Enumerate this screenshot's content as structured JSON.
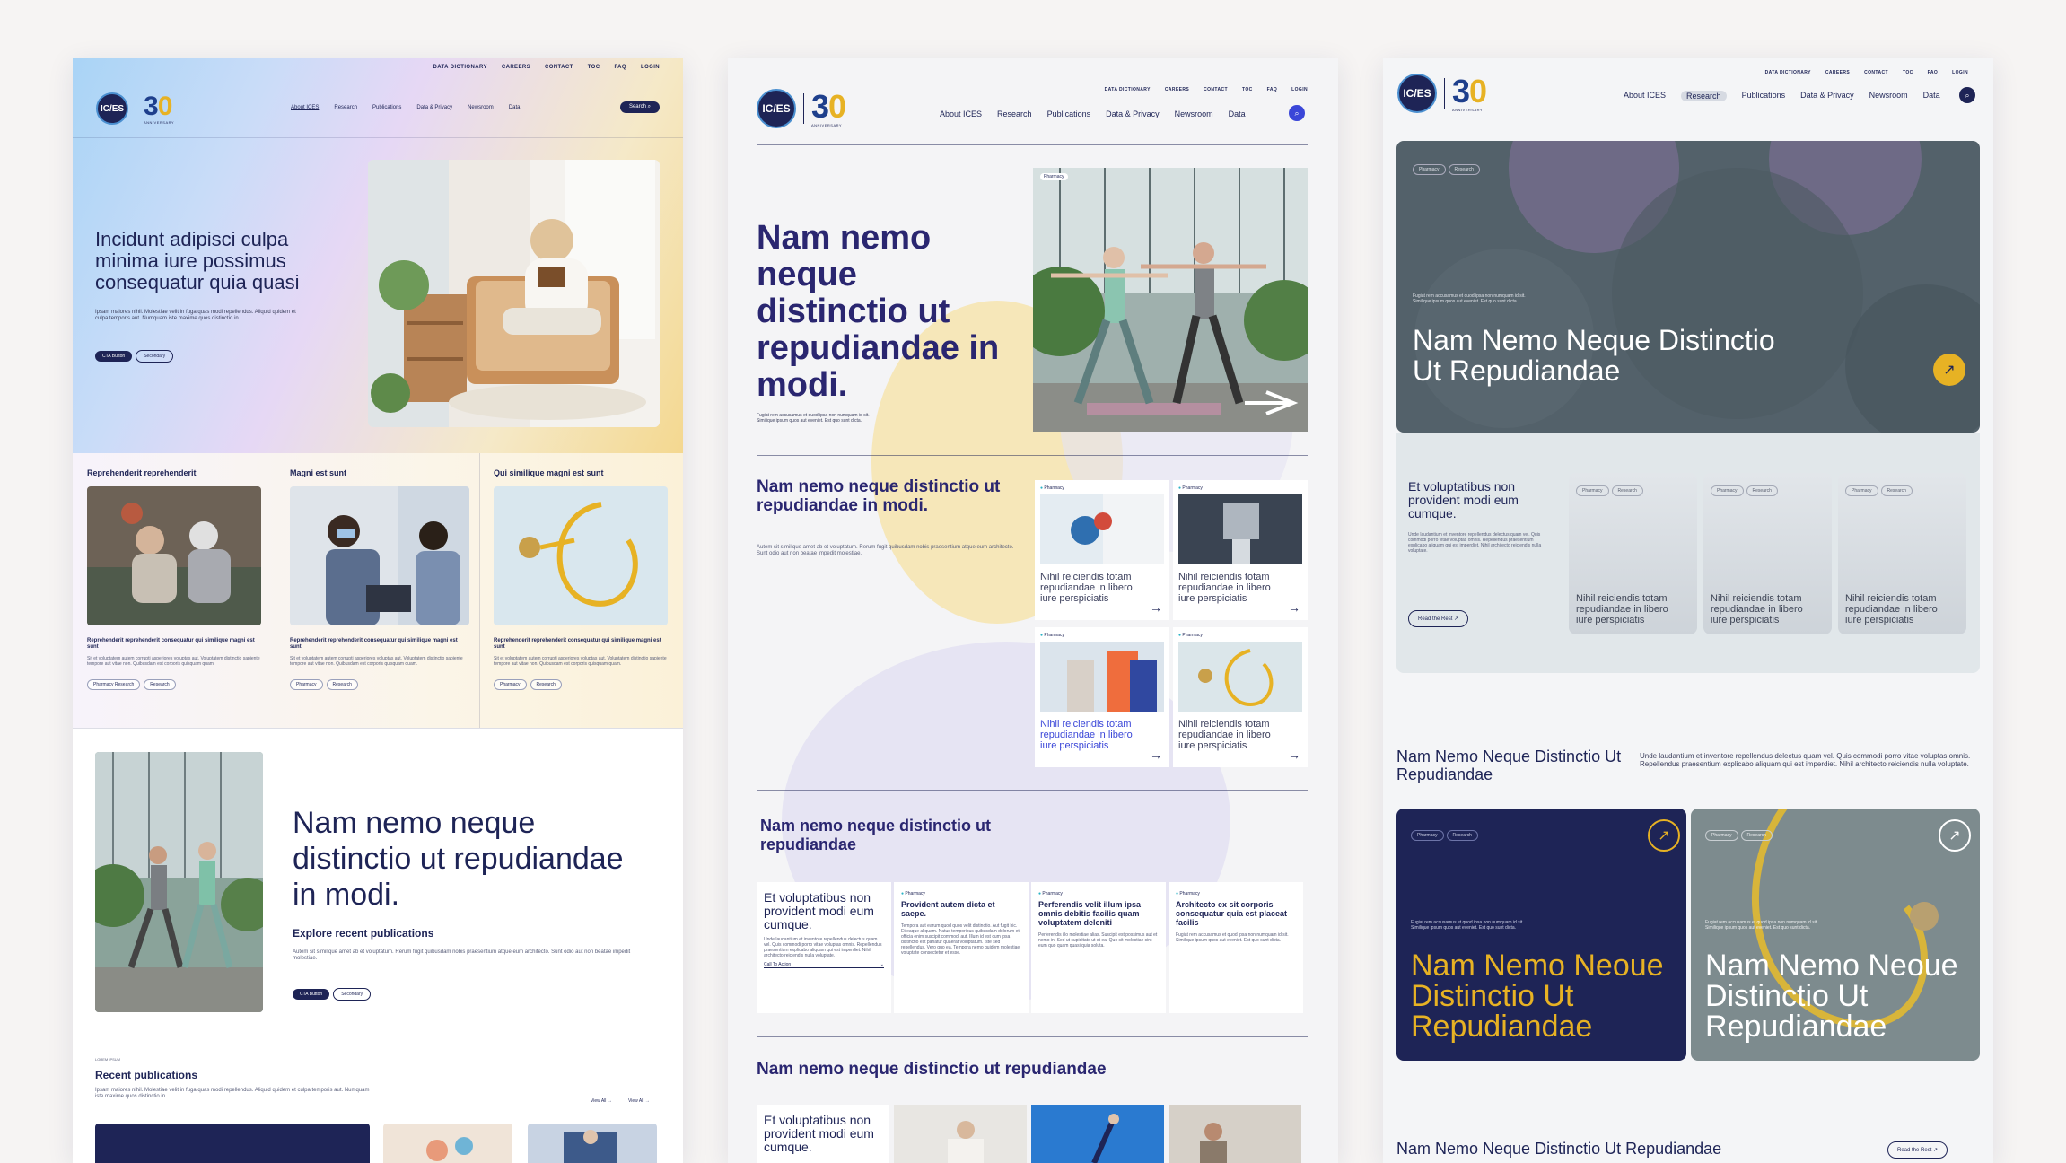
{
  "brand": {
    "logo_text": "IC/ES",
    "anniversary_number": "30",
    "anniversary_sub": "ANNIVERSARY"
  },
  "utility_nav": [
    "DATA DICTIONARY",
    "CAREERS",
    "CONTACT",
    "TOC",
    "FAQ",
    "LOGIN"
  ],
  "main_nav": [
    "About ICES",
    "Research",
    "Publications",
    "Data & Privacy",
    "Newsroom",
    "Data"
  ],
  "search_label": "Search",
  "p1": {
    "hero_title": "Incidunt adipisci culpa minima iure possimus consequatur quia quasi",
    "hero_body": "Ipsam maiores nihil. Molestiae velit in fuga quas modi repellendus. Aliquid quidem et culpa temporis aut. Numquam iste maxime quos distinctio in.",
    "cta_primary": "CTA Button",
    "cta_secondary": "Secondary",
    "cards": [
      {
        "heading": "Reprehenderit reprehenderit",
        "title": "Reprehenderit reprehenderit consequatur qui similique magni est sunt",
        "body": "Sit et voluptatem autem corrupti asperiores voluptas aut. Voluptatem distinctio sapiente tempore aut vitae non. Quibusdam est corporis quisquam quam.",
        "tags": [
          "Pharmacy Research",
          "Research"
        ]
      },
      {
        "heading": "Magni est sunt",
        "title": "Reprehenderit reprehenderit consequatur qui similique magni est sunt",
        "body": "Sit et voluptatem autem corrupti asperiores voluptas aut. Voluptatem distinctio sapiente tempore aut vitae non. Quibusdam est corporis quisquam quam.",
        "tags": [
          "Pharmacy",
          "Research"
        ]
      },
      {
        "heading": "Qui similique magni est sunt",
        "title": "Reprehenderit reprehenderit consequatur qui similique magni est sunt",
        "body": "Sit et voluptatem autem corrupti asperiores voluptas aut. Voluptatem distinctio sapiente tempore aut vitae non. Quibusdam est corporis quisquam quam.",
        "tags": [
          "Pharmacy",
          "Research"
        ]
      }
    ],
    "feature_title": "Nam nemo neque distinctio ut repudiandae in modi.",
    "feature_sub": "Explore recent publications",
    "feature_body": "Autem sit similique amet ab et voluptatum. Rerum fugit quibusdam nobis praesentium atque eum architecto. Sunt odio aut non beatae impedit molestiae.",
    "recent_eyebrow": "LOREM IPSUM",
    "recent_title": "Recent publications",
    "recent_body": "Ipsam maiores nihil. Molestiae velit in fuga quas modi repellendus. Aliquid quidem et culpa temporis aut. Numquam iste maxime quos distinctio in.",
    "view_all_1": "View All",
    "view_all_2": "View All"
  },
  "p2": {
    "hero_title": "Nam nemo neque distinctio ut repudiandae in modi.",
    "hero_body": "Fugiat rem accusamus et quod ipsa non numquam id sit. Similique ipsum quos aut eveniet. Est quo sunt dicta.",
    "hero_tag": "Pharmacy",
    "sec1_title": "Nam nemo neque distinctio ut repudiandae in modi.",
    "sec1_body": "Autem sit similique amet ab et voluptatum. Rerum fugit quibusdam nobis praesentium atque eum architecto. Sunt odio aut non beatae impedit molestiae.",
    "cards": [
      {
        "tag": "Pharmacy",
        "title": "Nihil reiciendis totam repudiandae in libero iure perspiciatis"
      },
      {
        "tag": "Pharmacy",
        "title": "Nihil reiciendis totam repudiandae in libero iure perspiciatis"
      },
      {
        "tag": "Pharmacy",
        "title": "Nihil reiciendis totam repudiandae in libero iure perspiciatis"
      },
      {
        "tag": "Pharmacy",
        "title": "Nihil reiciendis totam repudiandae in libero iure perspiciatis"
      }
    ],
    "sec2_title": "Nam nemo neque distinctio ut repudiandae",
    "row_cards": [
      {
        "tag": "",
        "title": "Et voluptatibus non provident modi eum cumque.",
        "body": "Unde laudantium et inventore repellendus delectus quam vel. Quis commodi porro vitae voluptas omnis. Repellendus praesentium explicabo aliquam qui est imperdiet. Nihil architecto reiciendis nulla voluptate.",
        "cta": "Call To Action"
      },
      {
        "tag": "Pharmacy",
        "title": "Provident autem dicta et saepe.",
        "body": "Tempora aut earum quod quos velit distinctio. Aut fugit hic. Et eaque aliquam. Natus temporibus quibusdam dolorum et officia enim suscipit commodi aut. Illum id est cum ipsa distinctio est pariatur quaerat voluptatum. Iste sed repellendus. Vero quo ea. Tempora nemo quidem molestiae voluptate consectetur et esse.",
        "cta": ""
      },
      {
        "tag": "Pharmacy",
        "title": "Perferendis velit illum ipsa omnis debitis facilis quam voluptatem deleniti",
        "body": "Perferendis illo molestiae alias. Suscipit est possimus aut et nemo in. Sed ut cupiditate ut et ea. Quo sit molestiae sint eum quo quam quasi quia soluta.",
        "cta": ""
      },
      {
        "tag": "Pharmacy",
        "title": "Architecto ex sit corporis consequatur quia est placeat facilis",
        "body": "Fugiat rem accusamus et quod ipsa non numquam id sit. Similique ipsum quos aut eveniet. Est quo sunt dicta.",
        "cta": ""
      }
    ],
    "sec3_title": "Nam nemo neque distinctio ut repudiandae",
    "bottom_card_title": "Et voluptatibus non provident modi eum cumque."
  },
  "p3": {
    "hero_tags": [
      "Pharmacy",
      "Research"
    ],
    "hero_small": "Fugiat rem accusamus et quod ipsa non numquam id sit. Similique ipsum quos aut eveniet. Est quo sunt dicta.",
    "hero_title": "Nam Nemo Neque Distinctio Ut Repudiandae",
    "panel_title": "Et voluptatibus non provident modi eum cumque.",
    "panel_body": "Unde laudantium et inventore repellendus delectus quam vel. Quis commodi porro vitae voluptas omnis. Repellendus praesentium explicabo aliquam qui est imperdiet. Nihil architecto reiciendis nulla voluptate.",
    "read_rest": "Read the Rest",
    "mini_cards": [
      {
        "tags": [
          "Pharmacy",
          "Research"
        ],
        "title": "Nihil reiciendis totam repudiandae in libero iure perspiciatis"
      },
      {
        "tags": [
          "Pharmacy",
          "Research"
        ],
        "title": "Nihil reiciendis totam repudiandae in libero iure perspiciatis"
      },
      {
        "tags": [
          "Pharmacy",
          "Research"
        ],
        "title": "Nihil reiciendis totam repudiandae in libero iure perspiciatis"
      }
    ],
    "sec_title": "Nam Nemo Neque Distinctio Ut Repudiandae",
    "sec_body": "Unde laudantium et inventore repellendus delectus quam vel. Quis commodi porro vitae voluptas omnis. Repellendus praesentium explicabo aliquam qui est imperdiet. Nihil architecto reiciendis nulla voluptate.",
    "big_cards": [
      {
        "tags": [
          "Pharmacy",
          "Research"
        ],
        "small": "Fugiat rem accusamus et quod ipsa non numquam id sit. Similique ipsum quos aut eveniet. Est quo sunt dicta.",
        "title": "Nam Nemo Neoue Distinctio Ut Repudiandae"
      },
      {
        "tags": [
          "Pharmacy",
          "Research"
        ],
        "small": "Fugiat rem accusamus et quod ipsa non numquam id sit. Similique ipsum quos aut eveniet. Est quo sunt dicta.",
        "title": "Nam Nemo Neoue Distinctio Ut Repudiandae"
      }
    ],
    "footer_title": "Nam Nemo Neque Distinctio Ut Repudiandae",
    "footer_read": "Read the Rest"
  },
  "colors": {
    "navy": "#1e2456",
    "accent_blue": "#3a46d8",
    "gold": "#e7b224",
    "teal_tag": "#2ab3c6"
  }
}
